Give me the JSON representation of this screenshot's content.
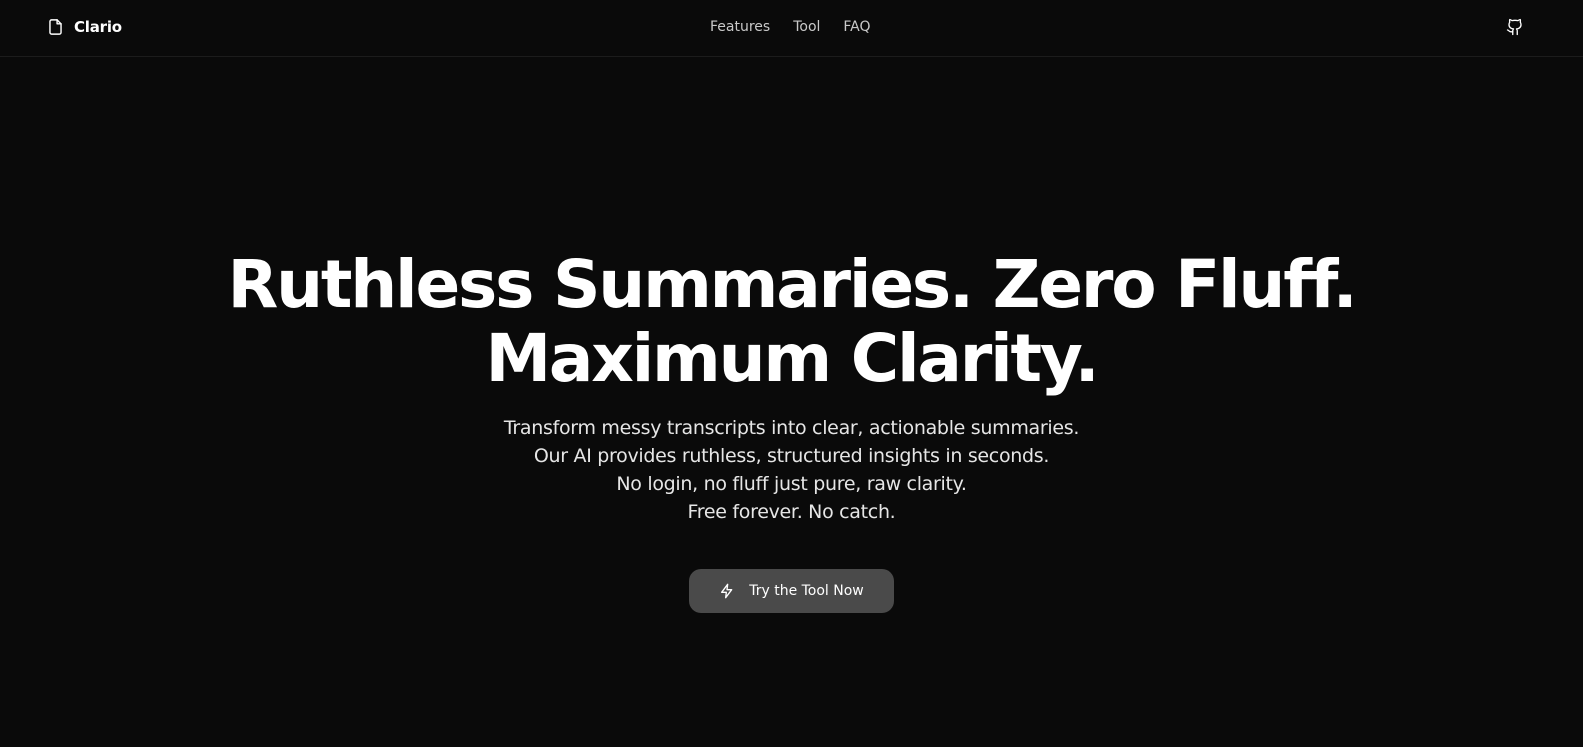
{
  "header": {
    "brand": {
      "name": "Clario",
      "icon": "file-icon"
    },
    "nav": [
      {
        "label": "Features"
      },
      {
        "label": "Tool"
      },
      {
        "label": "FAQ"
      }
    ],
    "github_icon": "github-icon"
  },
  "hero": {
    "title_lines": [
      "Ruthless Summaries. Zero Fluff.",
      "Maximum Clarity."
    ],
    "subtitle_lines": [
      "Transform messy transcripts into clear, actionable summaries.",
      "Our AI provides ruthless, structured insights in seconds.",
      "No login, no fluff just pure, raw clarity.",
      "Free forever. No catch."
    ],
    "cta": {
      "label": "Try the Tool Now",
      "icon": "lightning-icon"
    }
  },
  "colors": {
    "background": "#0a0a0a",
    "text": "#ffffff",
    "nav_text": "#c9c9c9",
    "button_bg": "#4a4a4a"
  }
}
